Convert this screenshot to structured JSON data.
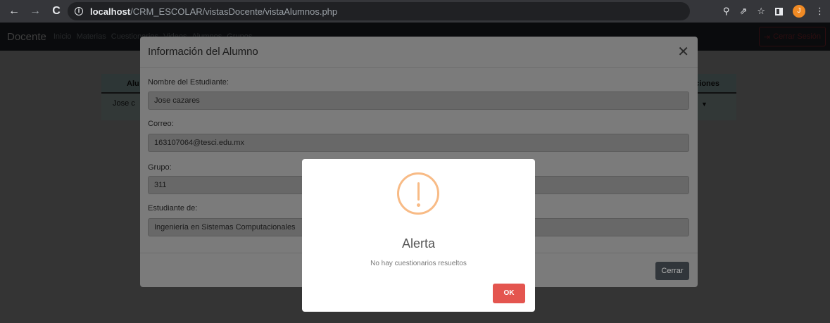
{
  "browser": {
    "url_host": "localhost",
    "url_path": "/CRM_ESCOLAR/vistasDocente/vistaAlumnos.php",
    "profile_initial": "J"
  },
  "navbar": {
    "brand": "Docente",
    "links": [
      "Inicio",
      "Materias",
      "Cuestionarios",
      "Videos",
      "Alumnos",
      "Grupos"
    ],
    "logout_label": "Cerrar Sesión"
  },
  "table": {
    "headers": [
      "Alu",
      "ciones"
    ],
    "rows": [
      [
        "Jose c"
      ]
    ]
  },
  "modal": {
    "title": "Información del Alumno",
    "fields": [
      {
        "label": "Nombre del Estudiante:",
        "value": "Jose cazares"
      },
      {
        "label": "Correo:",
        "value": "163107064@tesci.edu.mx"
      },
      {
        "label": "Grupo:",
        "value": "311"
      },
      {
        "label": "Estudiante de:",
        "value": "Ingeniería en Sistemas Computacionales"
      }
    ],
    "close_label": "Cerrar"
  },
  "alert": {
    "title": "Alerta",
    "text": "No hay cuestionarios resueltos",
    "ok_label": "OK"
  },
  "colors": {
    "warning": "#f8bb86",
    "confirm": "#e4554f",
    "chrome_bg": "#35363a"
  }
}
